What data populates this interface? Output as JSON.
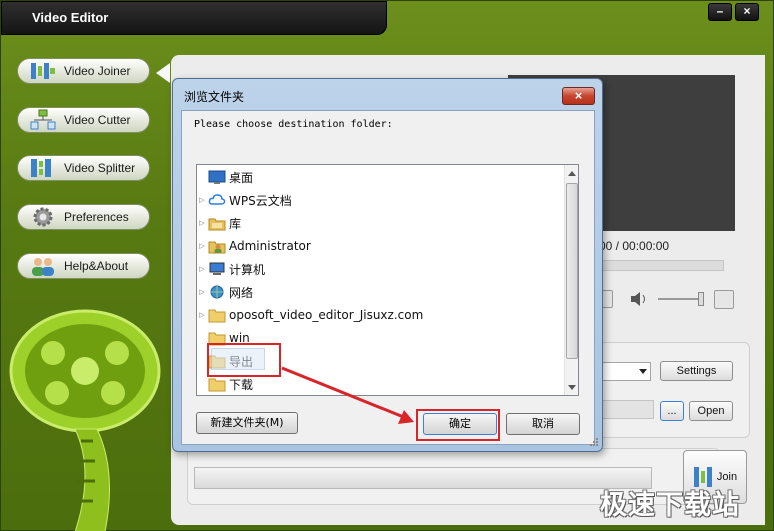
{
  "app": {
    "title": "Video Editor",
    "window_buttons": {
      "minimize": "–",
      "close": "×"
    }
  },
  "sidebar": {
    "items": [
      {
        "label": "Video Joiner",
        "icon": "joiner-icon",
        "active": true
      },
      {
        "label": "Video Cutter",
        "icon": "cutter-icon"
      },
      {
        "label": "Video Splitter",
        "icon": "splitter-icon"
      },
      {
        "label": "Preferences",
        "icon": "gear-icon"
      },
      {
        "label": "Help&About",
        "icon": "users-icon"
      }
    ]
  },
  "player": {
    "time": "00 / 00:00:00"
  },
  "output": {
    "settings_label": "Settings",
    "browse_label": "...",
    "open_label": "Open"
  },
  "join": {
    "label": "Join"
  },
  "dialog": {
    "title": "浏览文件夹",
    "close": "×",
    "prompt": "Please choose destination folder:",
    "tree": [
      {
        "label": "桌面",
        "icon": "desktop-icon",
        "expander": ""
      },
      {
        "label": "WPS云文档",
        "icon": "cloud-icon",
        "expander": "▷"
      },
      {
        "label": "库",
        "icon": "library-icon",
        "expander": "▷"
      },
      {
        "label": "Administrator",
        "icon": "user-folder-icon",
        "expander": "▷"
      },
      {
        "label": "计算机",
        "icon": "computer-icon",
        "expander": "▷"
      },
      {
        "label": "网络",
        "icon": "network-icon",
        "expander": "▷"
      },
      {
        "label": "oposoft_video_editor_Jisuxz.com",
        "icon": "folder-icon",
        "expander": "▷"
      },
      {
        "label": "win",
        "icon": "folder-icon",
        "expander": ""
      },
      {
        "label": "导出",
        "icon": "folder-icon",
        "expander": "",
        "selected": true
      },
      {
        "label": "下载",
        "icon": "folder-icon",
        "expander": ""
      }
    ],
    "new_folder_label": "新建文件夹(M)",
    "ok_label": "确定",
    "cancel_label": "取消"
  },
  "watermark": "极速下载站",
  "colors": {
    "app_green": "#587a12",
    "title_bar": "#1c1c1c",
    "dialog_frame": "#a9c4e0",
    "annotation_red": "#d8252a",
    "selection": "#dce9f7"
  }
}
